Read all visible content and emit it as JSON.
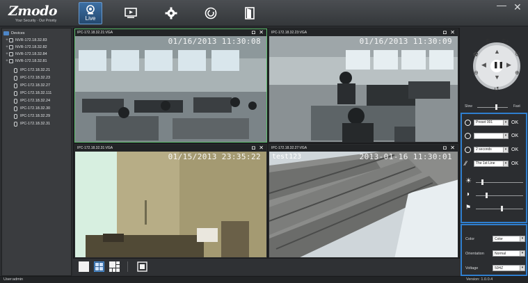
{
  "app": {
    "logo": "Zmodo",
    "tagline": "Your Security · Our Priority",
    "nav": [
      {
        "name": "live",
        "label": "Live",
        "icon": "camera-icon",
        "active": true
      },
      {
        "name": "playback",
        "label": "",
        "icon": "play-icon",
        "active": false
      },
      {
        "name": "settings",
        "label": "",
        "icon": "gear-icon",
        "active": false
      },
      {
        "name": "cloud",
        "label": "",
        "icon": "cloud-icon",
        "active": false
      },
      {
        "name": "logout",
        "label": "",
        "icon": "door-icon",
        "active": false
      }
    ],
    "window_buttons": {
      "minimize": "—",
      "close": "✕"
    }
  },
  "tree": {
    "root": "Devices",
    "nvrs": [
      "NVR-172.18.32.83",
      "NVR-172.18.32.82",
      "NVR-172.18.32.84",
      "NVR-172.18.32.81"
    ],
    "cameras": [
      "IPC-172.18.32.21",
      "IPC-172.18.32.23",
      "IPC-172.18.32.27",
      "IPC-172.18.32.111",
      "IPC-172.18.32.24",
      "IPC-172.18.32.30",
      "IPC-172.18.32.29",
      "IPC-172.18.32.31"
    ]
  },
  "tiles": [
    {
      "name": "IPC-172.18.32.21:VGA",
      "timestamp": "01/16/2013 11:30:08",
      "extra": ""
    },
    {
      "name": "IPC-172.18.32.23:VGA",
      "timestamp": "01/16/2013 11:30:09",
      "extra": ""
    },
    {
      "name": "IPC-172.18.32.31:VGA",
      "timestamp": "01/15/2013 23:35:22",
      "extra": ""
    },
    {
      "name": "IPC-172.18.32.27:VGA",
      "timestamp": "2013-01-16 11:30:01",
      "extra": "test123"
    }
  ],
  "tile_icons": {
    "snapshot": "camera-icon",
    "close": "close-icon"
  },
  "layout_options": [
    "single-view",
    "quad-view",
    "nine-view",
    "fullscreen"
  ],
  "ptz": {
    "focus_minus": "F-",
    "focus_plus": "F+",
    "speed_slow": "Slow",
    "speed_fast": "Fast"
  },
  "presets": {
    "preset_value": "Preset 001",
    "cruise_value": "",
    "interval_value": "2 seconds",
    "line_value": "The 1st Line",
    "ok_label": "OK"
  },
  "properties": {
    "color_label": "Color",
    "color_value": "Color",
    "orientation_label": "Orientation",
    "orientation_value": "Normal",
    "voltage_label": "Voltage",
    "voltage_value": "50HZ"
  },
  "status": {
    "user": "User:admin",
    "version": "Version: 1.0.0.4"
  }
}
